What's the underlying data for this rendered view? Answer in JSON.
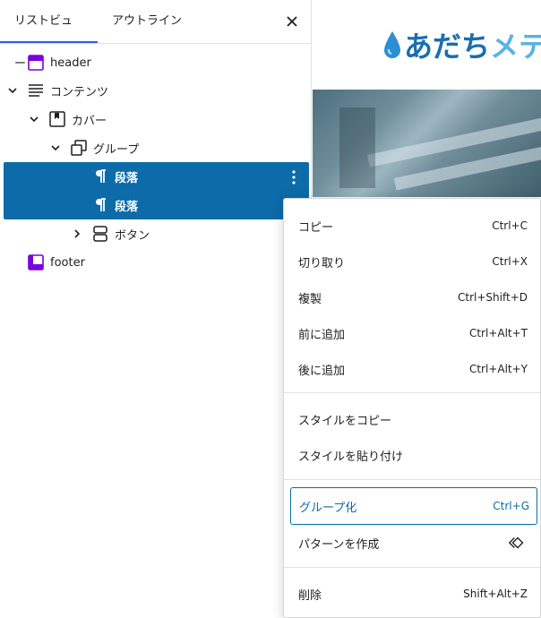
{
  "tabs": {
    "list_view": "リストビュー",
    "outline": "アウトライン"
  },
  "tree": {
    "header": "header",
    "content": "コンテンツ",
    "cover": "カバー",
    "group": "グループ",
    "paragraph1": "段落",
    "paragraph2": "段落",
    "buttons": "ボタン",
    "footer": "footer"
  },
  "preview": {
    "logo_part1": "あだち",
    "logo_part2": "メテ"
  },
  "menu": {
    "copy": {
      "label": "コピー",
      "shortcut": "Ctrl+C"
    },
    "cut": {
      "label": "切り取り",
      "shortcut": "Ctrl+X"
    },
    "duplicate": {
      "label": "複製",
      "shortcut": "Ctrl+Shift+D"
    },
    "insert_before": {
      "label": "前に追加",
      "shortcut": "Ctrl+Alt+T"
    },
    "insert_after": {
      "label": "後に追加",
      "shortcut": "Ctrl+Alt+Y"
    },
    "copy_styles": {
      "label": "スタイルをコピー"
    },
    "paste_styles": {
      "label": "スタイルを貼り付け"
    },
    "group": {
      "label": "グループ化",
      "shortcut": "Ctrl+G"
    },
    "create_pattern": {
      "label": "パターンを作成"
    },
    "delete": {
      "label": "削除",
      "shortcut": "Shift+Alt+Z"
    }
  },
  "colors": {
    "selection": "#0c6ba8",
    "tab_underline": "#3858e9",
    "template_part_icon": "#7a00df",
    "logo_dark": "#1a6db0",
    "logo_light": "#58b2e6"
  }
}
